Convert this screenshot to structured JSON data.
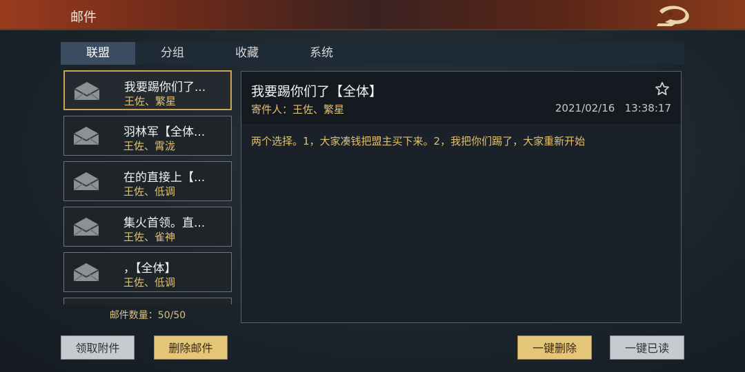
{
  "header": {
    "title": "邮件",
    "logo_icon": "dragon-logo-icon"
  },
  "tabs": [
    {
      "label": "联盟",
      "active": true
    },
    {
      "label": "分组",
      "active": false
    },
    {
      "label": "收藏",
      "active": false
    },
    {
      "label": "系统",
      "active": false
    }
  ],
  "mail_list": [
    {
      "subject": "我要踢你们了...",
      "sender": "王佐、繁星",
      "selected": true
    },
    {
      "subject": "羽林军【全体...",
      "sender": "王佐、霄泷",
      "selected": false
    },
    {
      "subject": "在的直接上【...",
      "sender": "王佐、低调",
      "selected": false
    },
    {
      "subject": "集火首领。直...",
      "sender": "王佐、雀神",
      "selected": false
    },
    {
      "subject": "，【全体】",
      "sender": "王佐、低调",
      "selected": false
    }
  ],
  "mail_count": "邮件数量：50/50",
  "detail": {
    "title": "我要踢你们了【全体】",
    "sender": "寄件人：王佐、繁星",
    "datetime": "2021/02/16   13:38:17",
    "body": "两个选择。1，大家凑钱把盟主买下来。2，我把你们踢了，大家重新开始"
  },
  "buttons": {
    "claim_attachments": "领取附件",
    "delete_mail": "删除邮件",
    "delete_all": "一键删除",
    "read_all": "一键已读"
  },
  "colors": {
    "gold_text": "#e2c070",
    "selected_border": "#c9a650",
    "gold_button": "#e5c679"
  }
}
